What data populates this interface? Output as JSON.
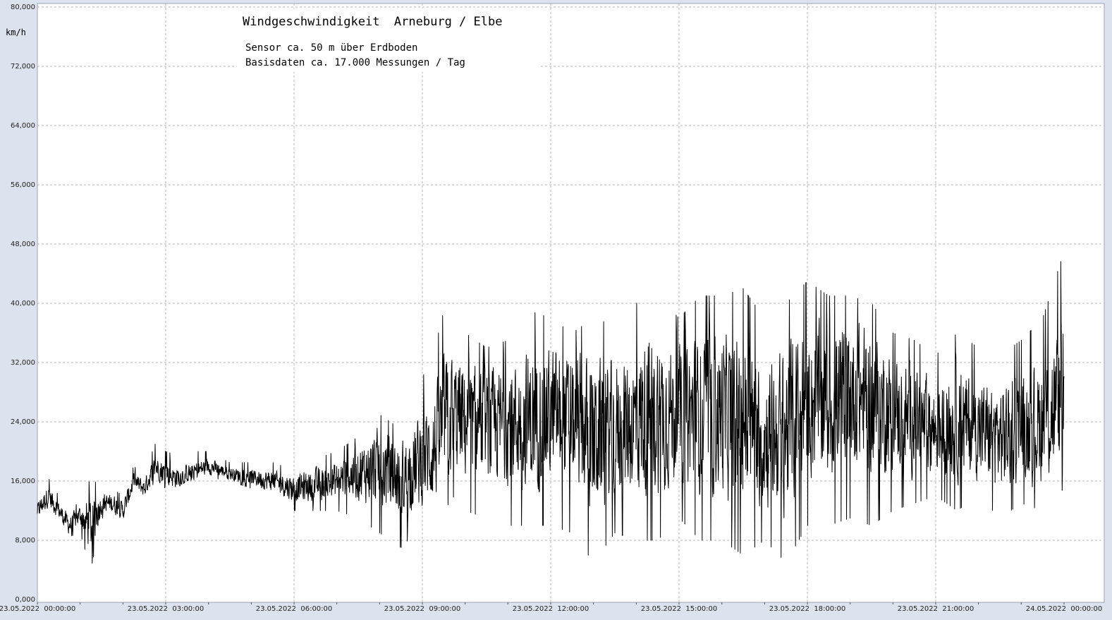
{
  "chart_data": {
    "type": "line",
    "title": "Windgeschwindigkeit  Arneburg / Elbe",
    "subtitle_lines": [
      "Sensor ca. 50 m über Erdboden",
      "Basisdaten ca. 17.000 Messungen / Tag"
    ],
    "ylabel": "km/h",
    "xlabel": "",
    "ylim": [
      0,
      80
    ],
    "y_ticks": [
      "0,000",
      "8,000",
      "16,000",
      "24,000",
      "32,000",
      "40,000",
      "48,000",
      "56,000",
      "64,000",
      "72,000",
      "80,000"
    ],
    "x_ticks": [
      "23.05.2022  00:00:00",
      "23.05.2022  03:00:00",
      "23.05.2022  06:00:00",
      "23.05.2022  09:00:00",
      "23.05.2022  12:00:00",
      "23.05.2022  15:00:00",
      "23.05.2022  18:00:00",
      "23.05.2022  21:00:00",
      "24.05.2022  00:00:00"
    ],
    "grid": true,
    "series": [
      {
        "color": "#000000",
        "x_hours": [
          0,
          0.25,
          0.5,
          0.75,
          1,
          1.25,
          1.5,
          1.75,
          2,
          2.25,
          2.5,
          2.75,
          3,
          3.25,
          3.5,
          4,
          4.5,
          5,
          5.5,
          6,
          6.5,
          7,
          7.5,
          8,
          8.5,
          9,
          9.25,
          9.5,
          9.75,
          10,
          10.5,
          11,
          11.5,
          12,
          12.5,
          13,
          13.5,
          14,
          14.5,
          15,
          15.5,
          16,
          16.5,
          17,
          17.5,
          18,
          18.5,
          19,
          19.5,
          20,
          20.5,
          21,
          21.5,
          22,
          22.5,
          23,
          23.5,
          24
        ],
        "mean": [
          12,
          14,
          12,
          10,
          11.5,
          10,
          13,
          13,
          12,
          16,
          15,
          18,
          17,
          16.5,
          17,
          18,
          17,
          16.5,
          16,
          15,
          15.5,
          16,
          17,
          18,
          16,
          19,
          20,
          24,
          25,
          24,
          23,
          24,
          24,
          25,
          24,
          22,
          23,
          24,
          25,
          25,
          25,
          25,
          24,
          22,
          23,
          27,
          26,
          28,
          27,
          25,
          24,
          23,
          24,
          23,
          22,
          23,
          24,
          27
        ],
        "low": [
          10.5,
          12,
          10.5,
          8.5,
          9,
          4,
          11,
          11,
          10,
          14,
          13.5,
          16,
          15,
          15,
          16,
          16.5,
          16,
          15,
          14,
          12,
          12,
          12,
          11,
          9,
          7,
          10,
          11,
          12,
          14,
          12,
          11,
          10,
          10,
          10,
          9,
          5,
          9,
          8,
          8,
          11,
          8,
          8,
          6,
          8,
          5,
          10,
          10,
          11,
          10,
          12,
          13,
          14,
          12,
          14,
          11,
          13,
          12,
          15
        ],
        "high": [
          14,
          16.5,
          14,
          12.5,
          13,
          16.5,
          15,
          15,
          14,
          18,
          17,
          21,
          20,
          19.5,
          20,
          20,
          18.5,
          18.5,
          18.5,
          17.5,
          19,
          20,
          22,
          25,
          23,
          30,
          33,
          39,
          39,
          36,
          34,
          35,
          39,
          38,
          36,
          38,
          37,
          40,
          41,
          38,
          41,
          41,
          42,
          38,
          40,
          43,
          41,
          41,
          40,
          36,
          35,
          33,
          36,
          34,
          33,
          35,
          38,
          47
        ]
      }
    ]
  }
}
